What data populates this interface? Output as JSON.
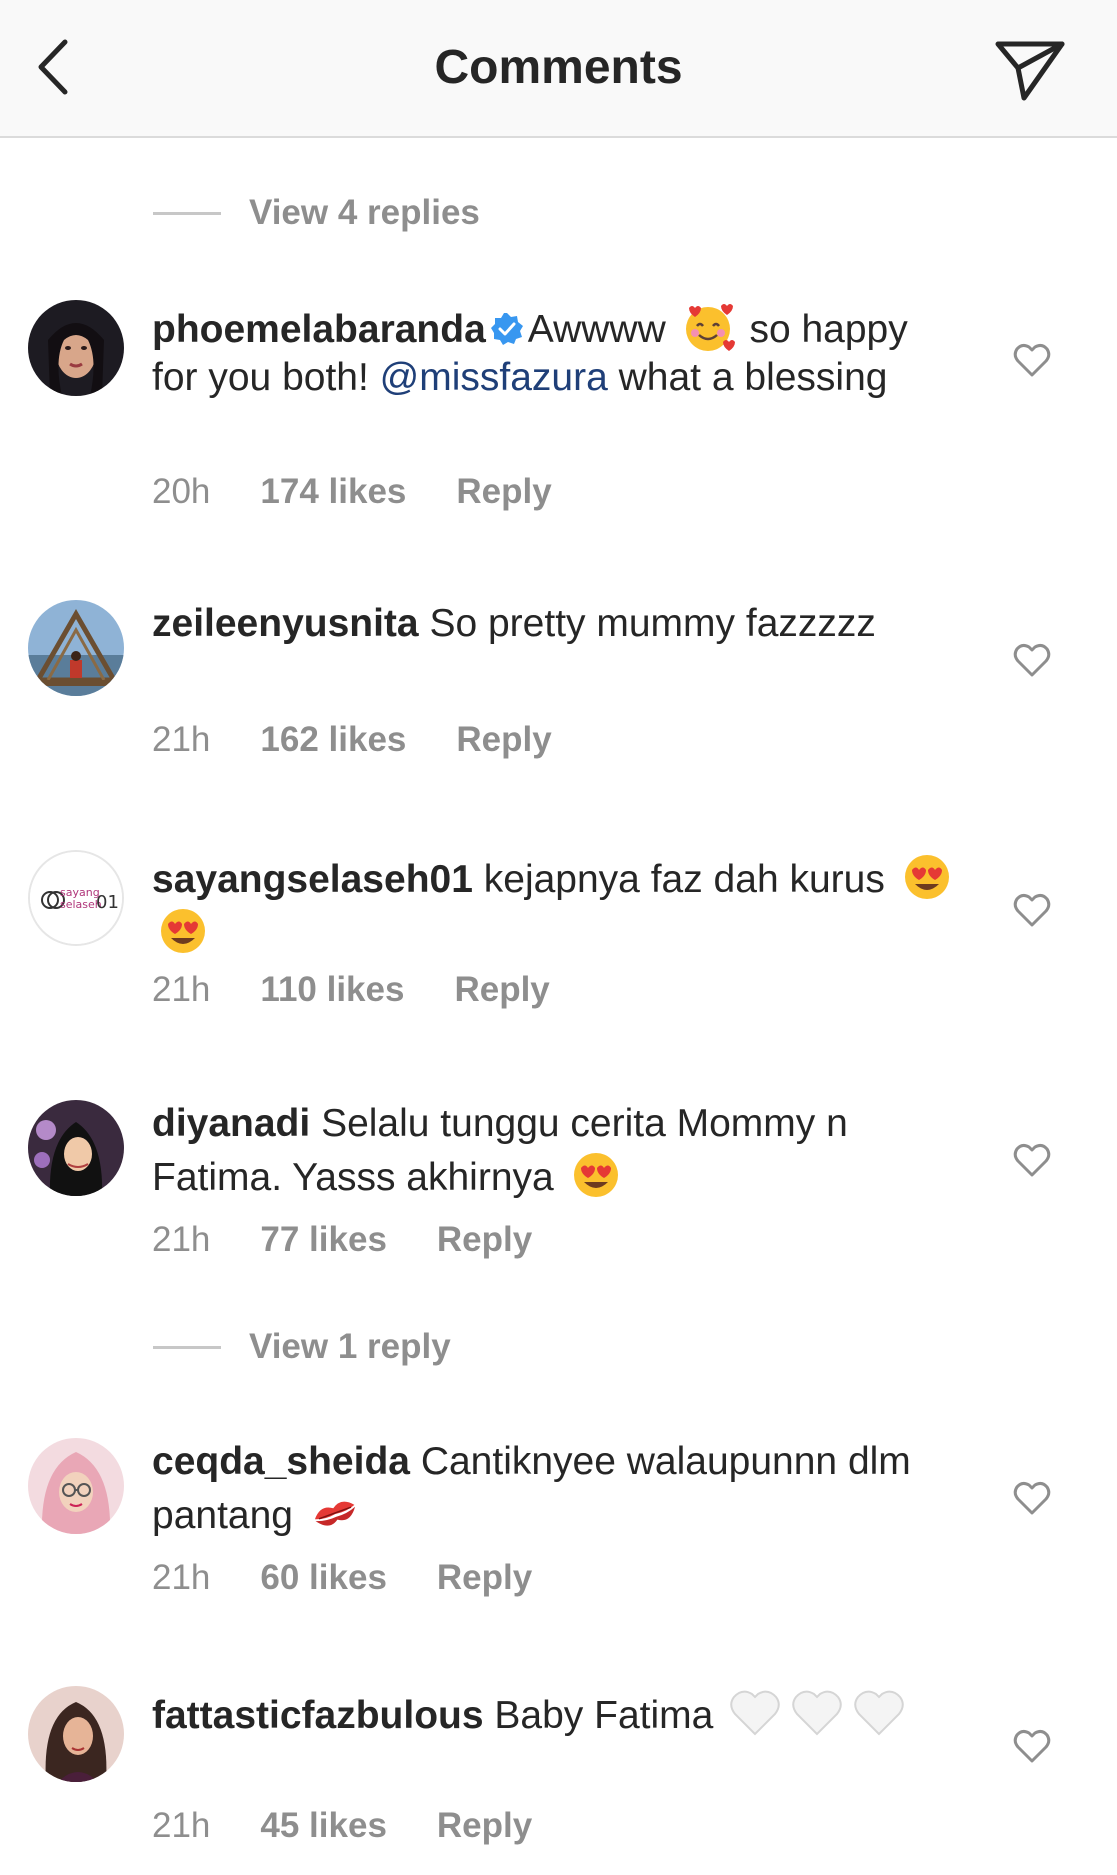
{
  "header": {
    "title": "Comments"
  },
  "view_replies_1": "View 4 replies",
  "view_replies_2": "View 1 reply",
  "comments": [
    {
      "username": "phoemelabaranda",
      "text_1": "Awwww",
      "text_2": "so happy for you both!",
      "mention": "@missfazura",
      "text_3": "what a blessing",
      "time": "20h",
      "likes": "174 likes",
      "reply": "Reply"
    },
    {
      "username": "zeileenyusnita",
      "text_1": "So pretty mummy fazzzzz",
      "time": "21h",
      "likes": "162 likes",
      "reply": "Reply"
    },
    {
      "username": "sayangselaseh01",
      "text_1": "kejapnya faz dah kurus",
      "avatar_text": "sayang selaseh01",
      "time": "21h",
      "likes": "110 likes",
      "reply": "Reply"
    },
    {
      "username": "diyanadi",
      "text_1": "Selalu tunggu cerita Mommy n Fatima. Yasss akhirnya",
      "time": "21h",
      "likes": "77 likes",
      "reply": "Reply"
    },
    {
      "username": "ceqda_sheida",
      "text_1": "Cantiknyee walaupunnn dlm pantang",
      "time": "21h",
      "likes": "60 likes",
      "reply": "Reply"
    },
    {
      "username": "fattasticfazbulous",
      "text_1": "Baby Fatima",
      "time": "21h",
      "likes": "45 likes",
      "reply": "Reply"
    }
  ],
  "colors": {
    "text": "#262626",
    "secondary": "#8e8e8e",
    "mention": "#1f3f78",
    "verified": "#3897f0"
  },
  "icons": [
    "back-chevron-icon",
    "direct-send-icon",
    "verified-badge-icon",
    "heart-outline-icon"
  ]
}
